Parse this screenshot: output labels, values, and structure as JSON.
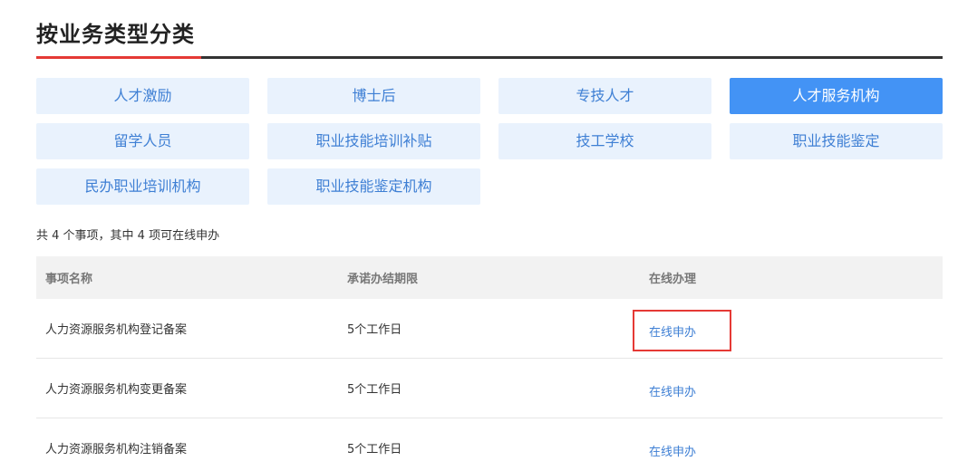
{
  "section": {
    "title": "按业务类型分类"
  },
  "categories": [
    {
      "label": "人才激励",
      "active": false
    },
    {
      "label": "博士后",
      "active": false
    },
    {
      "label": "专技人才",
      "active": false
    },
    {
      "label": "人才服务机构",
      "active": true
    },
    {
      "label": "留学人员",
      "active": false
    },
    {
      "label": "职业技能培训补贴",
      "active": false
    },
    {
      "label": "技工学校",
      "active": false
    },
    {
      "label": "职业技能鉴定",
      "active": false
    },
    {
      "label": "民办职业培训机构",
      "active": false
    },
    {
      "label": "职业技能鉴定机构",
      "active": false
    }
  ],
  "summary": "共 4 个事项，其中 4 项可在线申办",
  "table": {
    "headers": [
      "事项名称",
      "承诺办结期限",
      "在线办理"
    ],
    "rows": [
      {
        "name": "人力资源服务机构登记备案",
        "deadline": "5个工作日",
        "action": "在线申办"
      },
      {
        "name": "人力资源服务机构变更备案",
        "deadline": "5个工作日",
        "action": "在线申办"
      },
      {
        "name": "人力资源服务机构注销备案",
        "deadline": "5个工作日",
        "action": "在线申办"
      }
    ]
  },
  "colors": {
    "accent_red": "#e53935",
    "active_blue": "#4393f5",
    "button_bg": "#e9f2fd",
    "link_blue": "#3e7fd4"
  }
}
